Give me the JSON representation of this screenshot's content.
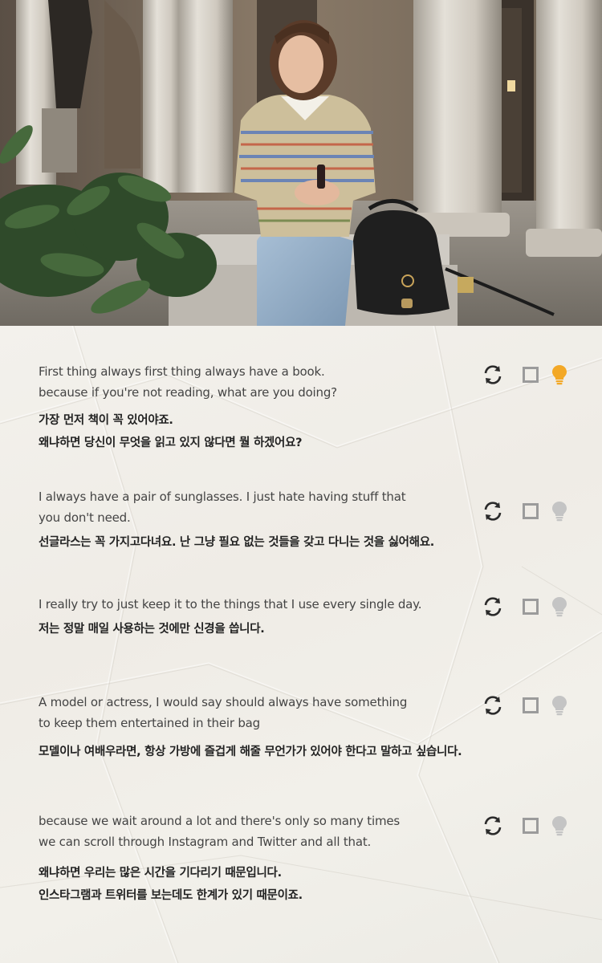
{
  "video": {
    "scene": "kaia-gerber-bag-video-frame"
  },
  "icons": {
    "repeat": "repeat-icon",
    "checkbox": "checkbox-icon",
    "hint": "lightbulb-icon"
  },
  "colors": {
    "hint_active": "#f3a826",
    "hint_inactive": "#c4c4c4",
    "repeat": "#2b2b2b",
    "checkbox": "#9b9b9b",
    "background": "#f1efea"
  },
  "sentences": [
    {
      "english": "First thing always first thing always have a book.\nbecause if you're not reading, what are you doing?",
      "korean": "가장 먼저 책이 꼭 있어야죠.\n왜냐하면 당신이 무엇을 읽고 있지 않다면 뭘 하겠어요?",
      "hint_active": true,
      "checked": false
    },
    {
      "english": "I always have a pair of sunglasses. I just hate having stuff that\nyou don't need.",
      "korean": "선글라스는 꼭 가지고다녀요. 난 그냥 필요 없는 것들을 갖고 다니는 것을 싫어해요.",
      "hint_active": false,
      "checked": false
    },
    {
      "english": "I really try to just keep it to the things that I use every single day.",
      "korean": "저는 정말 매일 사용하는 것에만 신경을 씁니다.",
      "hint_active": false,
      "checked": false
    },
    {
      "english": "A model or actress,  I would say should always have something\nto keep them entertained in their bag",
      "korean": "모델이나 여배우라면, 항상 가방에 즐겁게 해줄 무언가가 있어야 한다고 말하고 싶습니다.",
      "hint_active": false,
      "checked": false
    },
    {
      "english": "because we wait around a lot and there's only so many times\nwe can scroll through Instagram and Twitter and all that.",
      "korean": "왜냐하면 우리는 많은 시간을 기다리기 때문입니다.\n인스타그램과 트위터를 보는데도 한계가 있기 때문이죠.",
      "hint_active": false,
      "checked": false
    }
  ]
}
